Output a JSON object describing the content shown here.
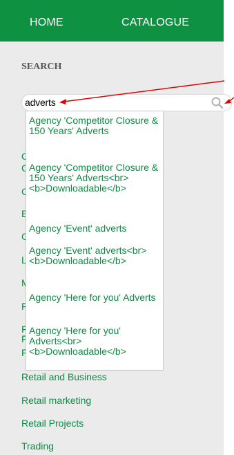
{
  "nav": {
    "home": "HOME",
    "catalogue": "CATALOGUE"
  },
  "search": {
    "heading": "SEARCH",
    "value": "adverts",
    "icon": "search-icon"
  },
  "categories": [
    "C",
    "C",
    "C",
    "E",
    "G",
    "L",
    "M",
    "F",
    "F",
    "F",
    "F",
    "Retail and Business",
    "Retail marketing",
    "Retail Projects",
    "Trading"
  ],
  "autocomplete": {
    "items": [
      "Agency 'Competitor Closure & 150 Years' Adverts",
      "Agency 'Competitor Closure & 150 Years' Adverts<br> <b>Downloadable</b>",
      "Agency 'Event' adverts",
      "Agency 'Event' adverts<br> <b>Downloadable</b>",
      "Agency 'Here for you' Adverts",
      "Agency 'Here for you' Adverts<br> <b>Downloadable</b>"
    ]
  },
  "colors": {
    "nav_bg": "#0e9140",
    "link": "#0e8a44",
    "sidebar_bg": "#ebebeb",
    "annotation": "#e00000"
  }
}
